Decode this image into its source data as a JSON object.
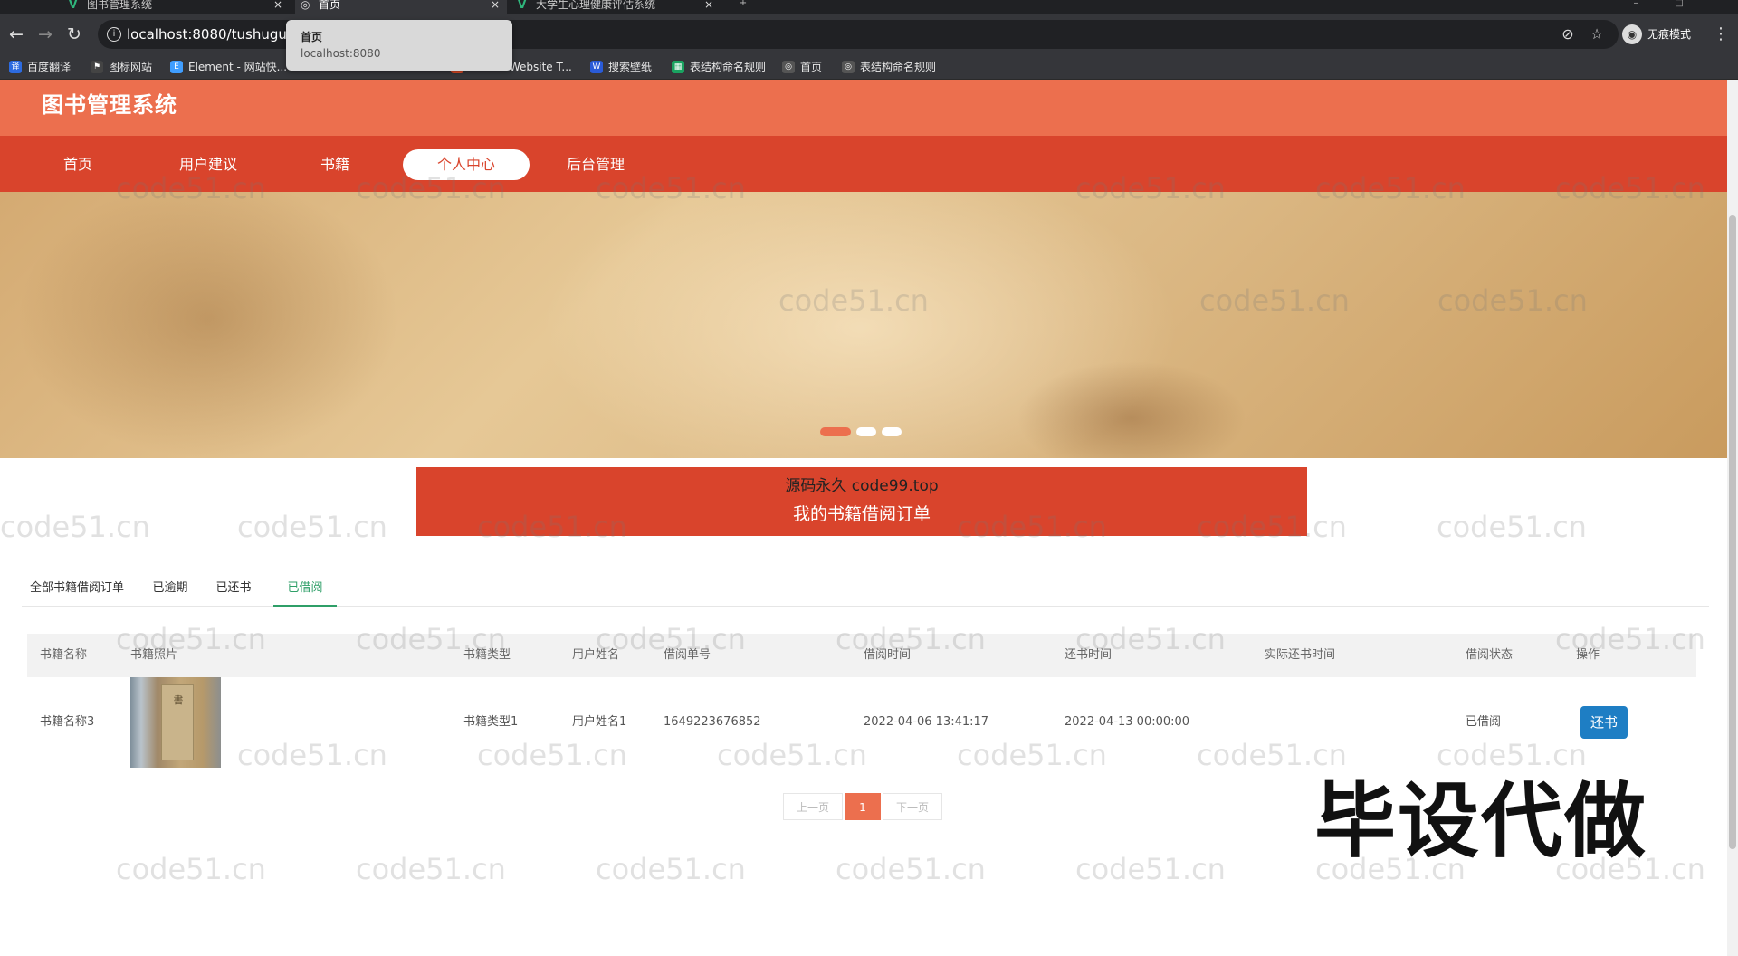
{
  "browser": {
    "tabs": [
      {
        "label": "图书管理系统"
      },
      {
        "label": "首页",
        "active": true
      },
      {
        "label": "大学生心理健康评估系统"
      }
    ],
    "url": "localhost:8080/tushuguan",
    "incognito_label": "无痕模式",
    "tooltip": {
      "title": "首页",
      "host": "localhost:8080"
    },
    "bookmarks": [
      "百度翻译",
      "图标网站",
      "Element - 网站快...",
      "HTML5 Website T...",
      "搜索壁纸",
      "表结构命名规则",
      "首页",
      "表结构命名规则"
    ]
  },
  "site": {
    "title": "图书管理系统",
    "nav": [
      "首页",
      "用户建议",
      "书籍",
      "个人中心",
      "后台管理"
    ],
    "active_nav": "个人中心"
  },
  "banner": {
    "slide_count": 3,
    "current_slide": 1
  },
  "order_section": {
    "watermark_text": "源码永久 code99.top",
    "title": "我的书籍借阅订单"
  },
  "tabs": [
    "全部书籍借阅订单",
    "已逾期",
    "已还书",
    "已借阅"
  ],
  "active_tab": "已借阅",
  "table": {
    "columns": [
      "书籍名称",
      "书籍照片",
      "书籍类型",
      "用户姓名",
      "借阅单号",
      "借阅时间",
      "还书时间",
      "实际还书时间",
      "借阅状态",
      "操作"
    ],
    "rows": [
      {
        "name": "书籍名称3",
        "type": "书籍类型1",
        "user": "用户姓名1",
        "order_no": "1649223676852",
        "borrow_time": "2022-04-06 13:41:17",
        "return_time": "2022-04-13 00:00:00",
        "actual_return_time": "",
        "status": "已借阅",
        "action_label": "还书"
      }
    ]
  },
  "pagination": {
    "prev": "上一页",
    "current": "1",
    "next": "下一页"
  },
  "overlay": {
    "promo_text": "毕设代做",
    "watermark": "code51.cn"
  },
  "colors": {
    "header": "#ec6f4e",
    "nav": "#d9442c",
    "accent_green": "#2f9f68",
    "button_blue": "#1e7ec4"
  }
}
